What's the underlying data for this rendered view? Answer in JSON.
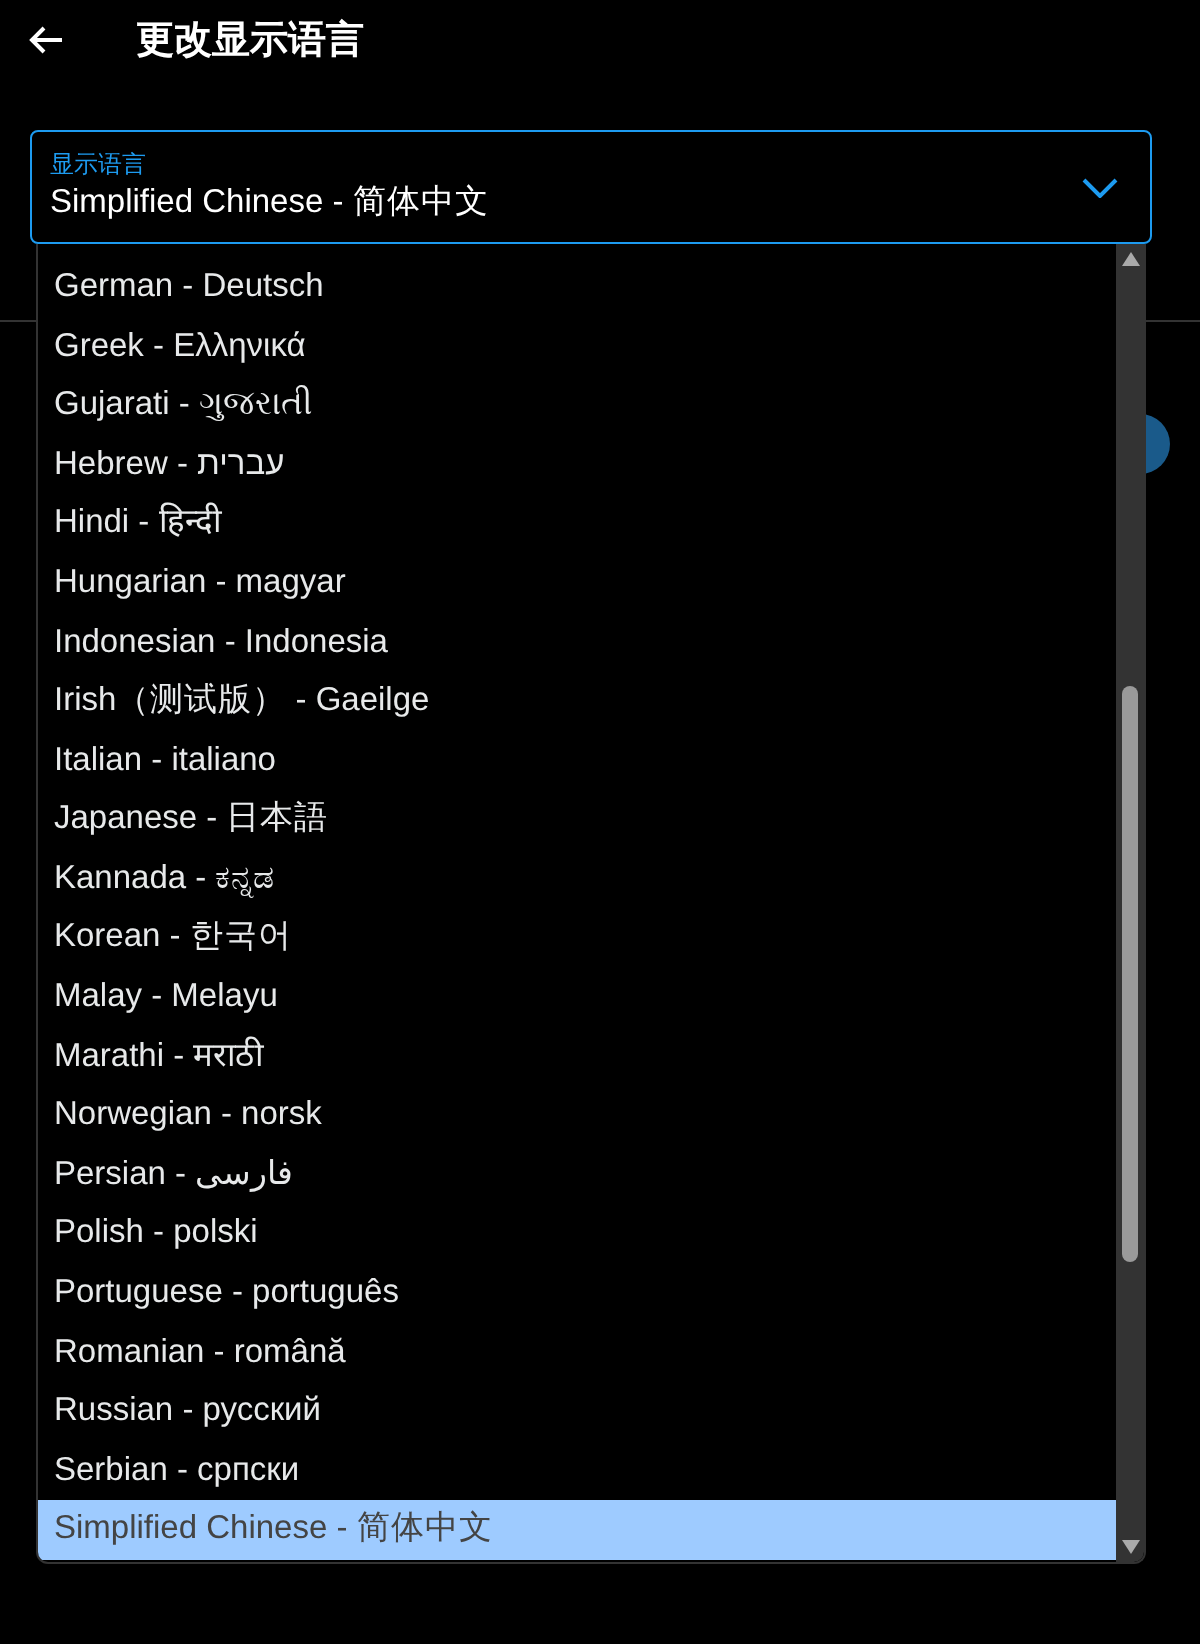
{
  "header": {
    "title": "更改显示语言"
  },
  "language_select": {
    "label": "显示语言",
    "value": "Simplified Chinese - 简体中文",
    "expanded": true
  },
  "options": [
    {
      "label": "German - Deutsch",
      "selected": false
    },
    {
      "label": "Greek - Ελληνικά",
      "selected": false
    },
    {
      "label": "Gujarati - ગુજરાતી",
      "selected": false
    },
    {
      "label": "Hebrew - עברית",
      "selected": false
    },
    {
      "label": "Hindi - हिन्दी",
      "selected": false
    },
    {
      "label": "Hungarian - magyar",
      "selected": false
    },
    {
      "label": "Indonesian - Indonesia",
      "selected": false
    },
    {
      "label": "Irish（测试版） - Gaeilge",
      "selected": false
    },
    {
      "label": "Italian - italiano",
      "selected": false
    },
    {
      "label": "Japanese - 日本語",
      "selected": false
    },
    {
      "label": "Kannada - ಕನ್ನಡ",
      "selected": false
    },
    {
      "label": "Korean - 한국어",
      "selected": false
    },
    {
      "label": "Malay - Melayu",
      "selected": false
    },
    {
      "label": "Marathi - मराठी",
      "selected": false
    },
    {
      "label": "Norwegian - norsk",
      "selected": false
    },
    {
      "label": "Persian - فارسی",
      "selected": false
    },
    {
      "label": "Polish - polski",
      "selected": false
    },
    {
      "label": "Portuguese - português",
      "selected": false
    },
    {
      "label": "Romanian - română",
      "selected": false
    },
    {
      "label": "Russian - русский",
      "selected": false
    },
    {
      "label": "Serbian - српски",
      "selected": false
    },
    {
      "label": "Simplified Chinese - 简体中文",
      "selected": true
    }
  ]
}
